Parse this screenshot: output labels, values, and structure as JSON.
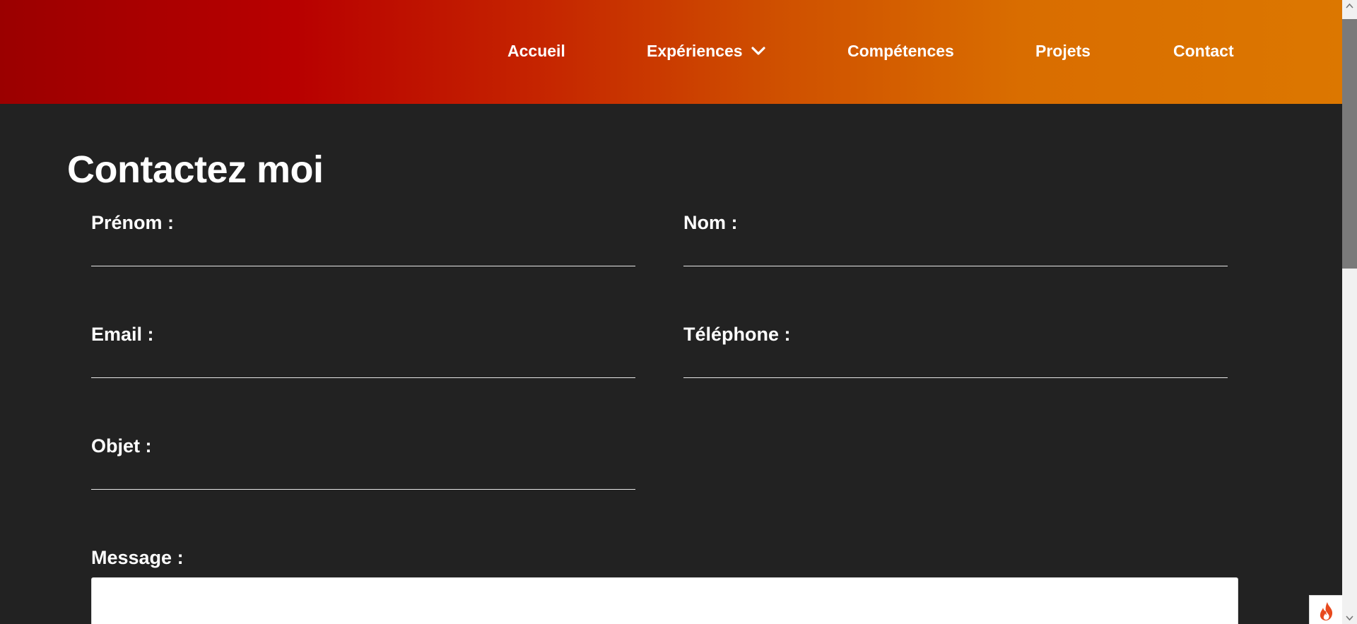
{
  "nav": {
    "items": [
      {
        "label": "Accueil"
      },
      {
        "label": "Expériences"
      },
      {
        "label": "Compétences"
      },
      {
        "label": "Projets"
      },
      {
        "label": "Contact"
      }
    ]
  },
  "page": {
    "title": "Contactez moi"
  },
  "form": {
    "prenom": {
      "label": "Prénom :",
      "value": ""
    },
    "nom": {
      "label": "Nom :",
      "value": ""
    },
    "email": {
      "label": "Email :",
      "value": ""
    },
    "telephone": {
      "label": "Téléphone :",
      "value": ""
    },
    "objet": {
      "label": "Objet :",
      "value": ""
    },
    "message": {
      "label": "Message :",
      "value": ""
    }
  },
  "colors": {
    "header_gradient_start": "#9b0000",
    "header_gradient_end": "#dc7700",
    "background": "#222222",
    "text": "#ffffff"
  },
  "icons": {
    "dropdown": "chevron-down-icon",
    "widget": "flame-icon"
  }
}
